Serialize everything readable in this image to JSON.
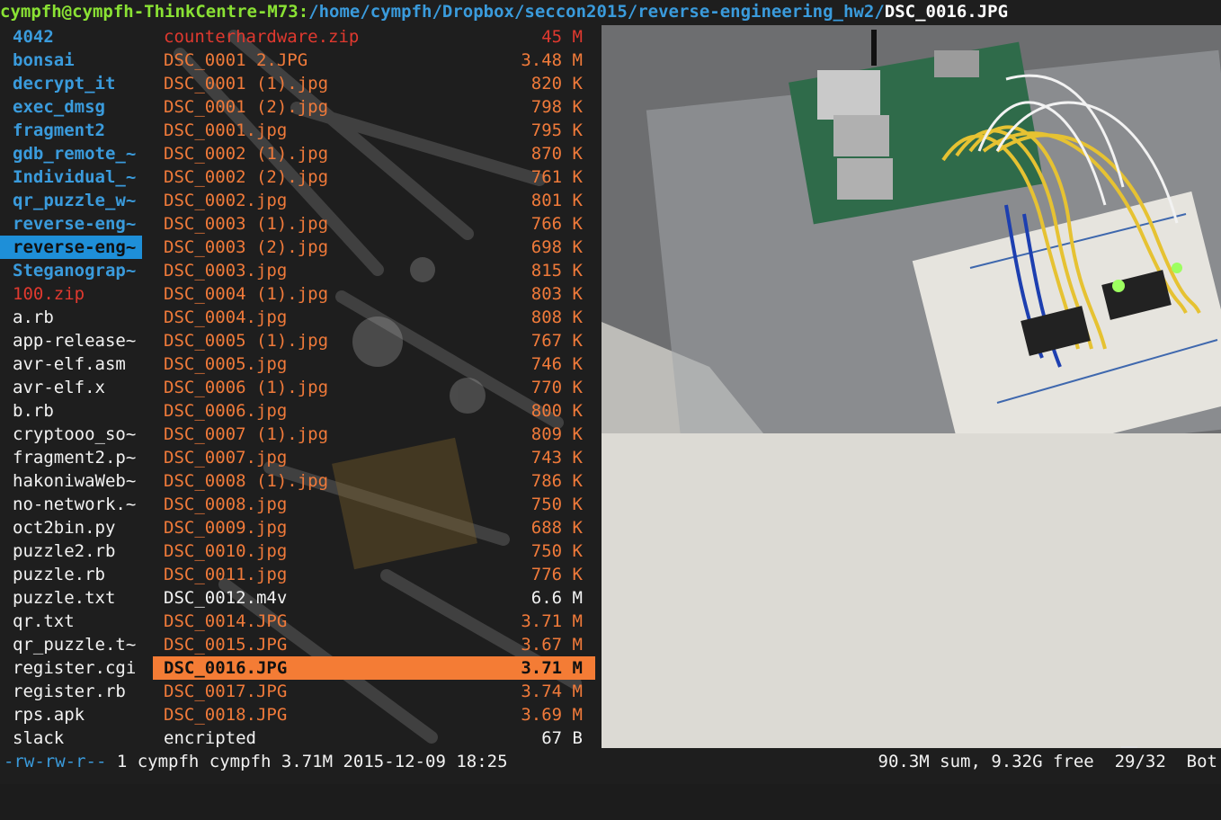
{
  "titlebar": {
    "host": "cympfh@cympfh-ThinkCentre-M73:",
    "path": "/home/cympfh/Dropbox/seccon2015/reverse-engineering_hw2/",
    "file": "DSC_0016.JPG"
  },
  "parent_entries": [
    {
      "name": "4042",
      "kind": "dir"
    },
    {
      "name": "bonsai",
      "kind": "dir"
    },
    {
      "name": "decrypt_it",
      "kind": "dir"
    },
    {
      "name": "exec_dmsg",
      "kind": "dir"
    },
    {
      "name": "fragment2",
      "kind": "dir"
    },
    {
      "name": "gdb_remote_~",
      "kind": "dir"
    },
    {
      "name": "Individual_~",
      "kind": "dir"
    },
    {
      "name": "qr_puzzle_w~",
      "kind": "dir"
    },
    {
      "name": "reverse-eng~",
      "kind": "dir"
    },
    {
      "name": "reverse-eng~",
      "kind": "dir",
      "selected": true
    },
    {
      "name": "Steganograp~",
      "kind": "dir"
    },
    {
      "name": "100.zip",
      "kind": "archive"
    },
    {
      "name": "a.rb",
      "kind": "file"
    },
    {
      "name": "app-release~",
      "kind": "file"
    },
    {
      "name": "avr-elf.asm",
      "kind": "file"
    },
    {
      "name": "avr-elf.x",
      "kind": "file"
    },
    {
      "name": "b.rb",
      "kind": "file"
    },
    {
      "name": "cryptooo_so~",
      "kind": "file"
    },
    {
      "name": "fragment2.p~",
      "kind": "file"
    },
    {
      "name": "hakoniwaWeb~",
      "kind": "file"
    },
    {
      "name": "no-network.~",
      "kind": "file"
    },
    {
      "name": "oct2bin.py",
      "kind": "file"
    },
    {
      "name": "puzzle2.rb",
      "kind": "file"
    },
    {
      "name": "puzzle.rb",
      "kind": "file"
    },
    {
      "name": "puzzle.txt",
      "kind": "file"
    },
    {
      "name": "qr.txt",
      "kind": "file"
    },
    {
      "name": "qr_puzzle.t~",
      "kind": "file"
    },
    {
      "name": "register.cgi",
      "kind": "file"
    },
    {
      "name": "register.rb",
      "kind": "file"
    },
    {
      "name": "rps.apk",
      "kind": "file"
    },
    {
      "name": "slack",
      "kind": "file"
    }
  ],
  "current_entries": [
    {
      "name": "counterhardware.zip",
      "size": "45 M",
      "kind": "archive"
    },
    {
      "name": "DSC_0001 2.JPG",
      "size": "3.48 M",
      "kind": "image"
    },
    {
      "name": "DSC_0001 (1).jpg",
      "size": "820 K",
      "kind": "image"
    },
    {
      "name": "DSC_0001 (2).jpg",
      "size": "798 K",
      "kind": "image"
    },
    {
      "name": "DSC_0001.jpg",
      "size": "795 K",
      "kind": "image"
    },
    {
      "name": "DSC_0002 (1).jpg",
      "size": "870 K",
      "kind": "image"
    },
    {
      "name": "DSC_0002 (2).jpg",
      "size": "761 K",
      "kind": "image"
    },
    {
      "name": "DSC_0002.jpg",
      "size": "801 K",
      "kind": "image"
    },
    {
      "name": "DSC_0003 (1).jpg",
      "size": "766 K",
      "kind": "image"
    },
    {
      "name": "DSC_0003 (2).jpg",
      "size": "698 K",
      "kind": "image"
    },
    {
      "name": "DSC_0003.jpg",
      "size": "815 K",
      "kind": "image"
    },
    {
      "name": "DSC_0004 (1).jpg",
      "size": "803 K",
      "kind": "image"
    },
    {
      "name": "DSC_0004.jpg",
      "size": "808 K",
      "kind": "image"
    },
    {
      "name": "DSC_0005 (1).jpg",
      "size": "767 K",
      "kind": "image"
    },
    {
      "name": "DSC_0005.jpg",
      "size": "746 K",
      "kind": "image"
    },
    {
      "name": "DSC_0006 (1).jpg",
      "size": "770 K",
      "kind": "image"
    },
    {
      "name": "DSC_0006.jpg",
      "size": "800 K",
      "kind": "image"
    },
    {
      "name": "DSC_0007 (1).jpg",
      "size": "809 K",
      "kind": "image"
    },
    {
      "name": "DSC_0007.jpg",
      "size": "743 K",
      "kind": "image"
    },
    {
      "name": "DSC_0008 (1).jpg",
      "size": "786 K",
      "kind": "image"
    },
    {
      "name": "DSC_0008.jpg",
      "size": "750 K",
      "kind": "image"
    },
    {
      "name": "DSC_0009.jpg",
      "size": "688 K",
      "kind": "image"
    },
    {
      "name": "DSC_0010.jpg",
      "size": "750 K",
      "kind": "image"
    },
    {
      "name": "DSC_0011.jpg",
      "size": "776 K",
      "kind": "image"
    },
    {
      "name": "DSC_0012.m4v",
      "size": "6.6 M",
      "kind": "file"
    },
    {
      "name": "DSC_0014.JPG",
      "size": "3.71 M",
      "kind": "image"
    },
    {
      "name": "DSC_0015.JPG",
      "size": "3.67 M",
      "kind": "image"
    },
    {
      "name": "DSC_0016.JPG",
      "size": "3.71 M",
      "kind": "image",
      "selected": true
    },
    {
      "name": "DSC_0017.JPG",
      "size": "3.74 M",
      "kind": "image"
    },
    {
      "name": "DSC_0018.JPG",
      "size": "3.69 M",
      "kind": "image"
    },
    {
      "name": "encripted",
      "size": "67 B",
      "kind": "file"
    }
  ],
  "preview": {
    "subject": "raspberry-pi-breadboard-photo"
  },
  "statusbar": {
    "permissions": "-rw-rw-r--",
    "info": " 1 cympfh cympfh 3.71M 2015-12-09 18:25",
    "summary": "90.3M sum, 9.32G free  29/32  Bot"
  },
  "colors": {
    "directory": "#3a9bdc",
    "archive": "#e0392f",
    "image": "#f07a3a",
    "hostname": "#8ae234",
    "selection_parent": "#1e8fd8",
    "selection_current": "#f47c35"
  }
}
